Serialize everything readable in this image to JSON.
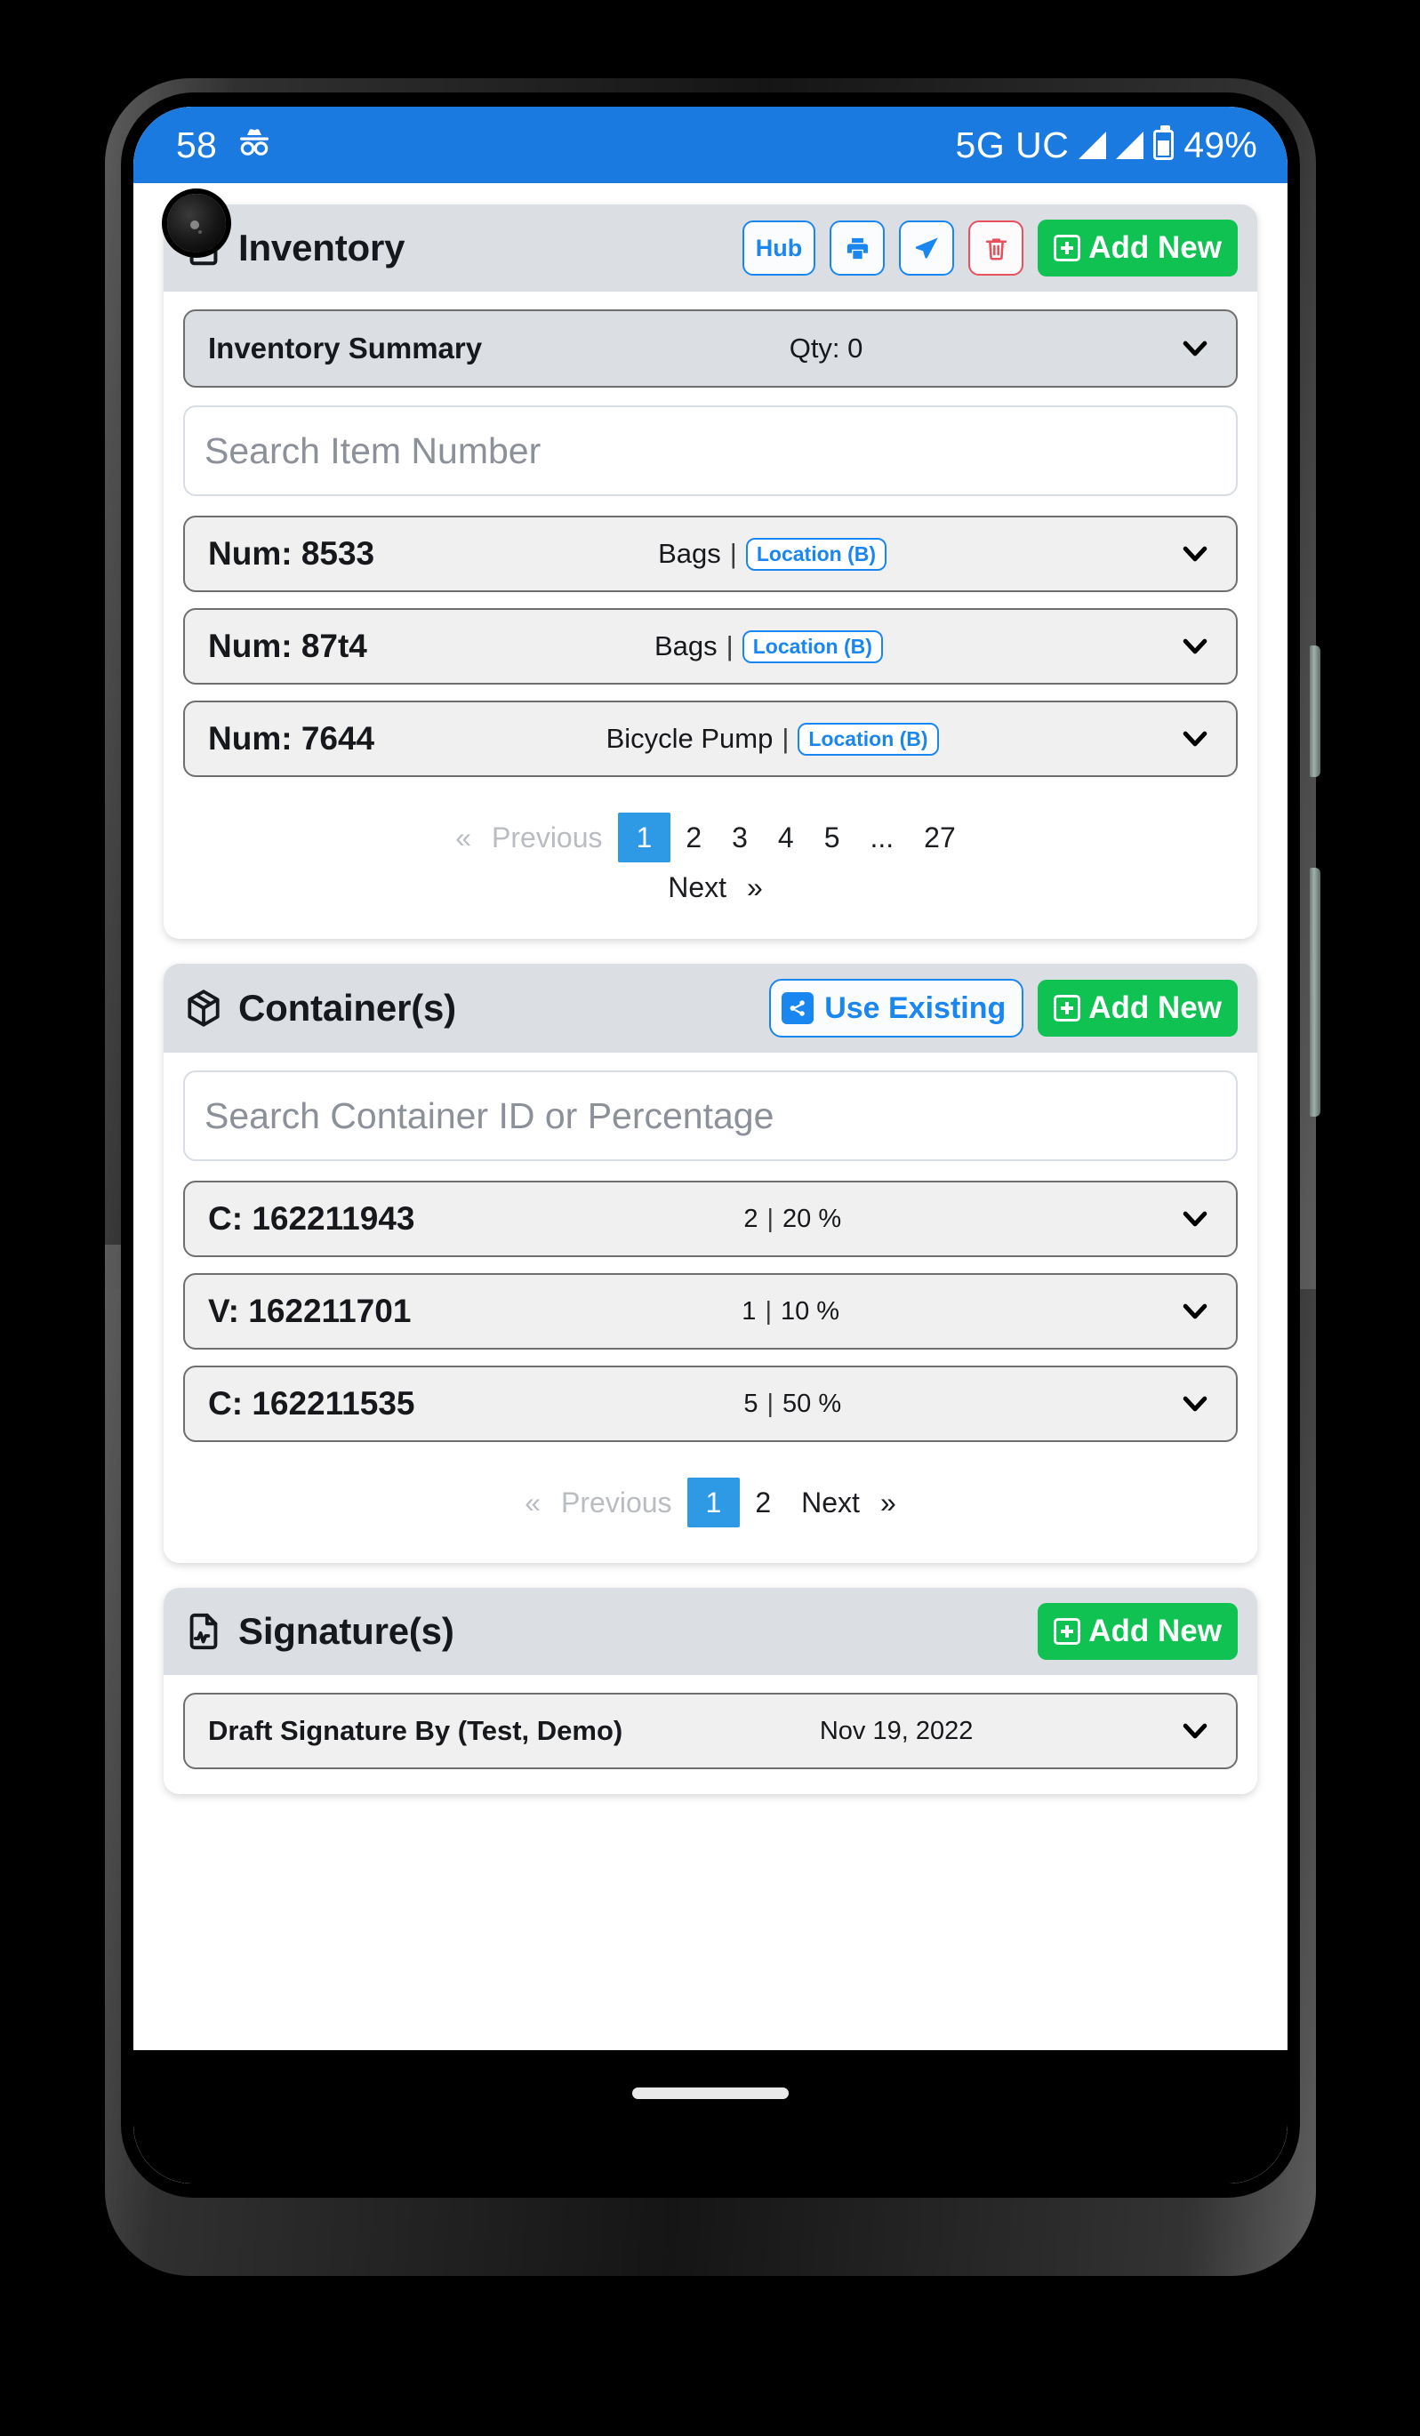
{
  "status_bar": {
    "time": "58",
    "incognito_icon": "incognito-icon",
    "network": "5G UC",
    "battery_percent": "49%"
  },
  "inventory_card": {
    "icon": "inventory-box-icon",
    "title": "Inventory",
    "hub_label": "Hub",
    "print_icon": "printer-icon",
    "send_icon": "paper-plane-icon",
    "delete_icon": "trash-icon",
    "add_new_label": "Add New",
    "summary": {
      "label": "Inventory Summary",
      "qty": "Qty: 0"
    },
    "search_placeholder": "Search Item Number",
    "search_value": "",
    "items": [
      {
        "num": "Num: 8533",
        "desc": "Bags",
        "sep": "|",
        "location": "Location (B)"
      },
      {
        "num": "Num: 87t4",
        "desc": "Bags",
        "sep": "|",
        "location": "Location (B)"
      },
      {
        "num": "Num: 7644",
        "desc": "Bicycle Pump",
        "sep": "|",
        "location": "Location (B)"
      }
    ],
    "pagination": {
      "prev_chevron": "«",
      "prev_label": "Previous",
      "pages": [
        "1",
        "2",
        "3",
        "4",
        "5",
        "...",
        "27"
      ],
      "active_page": "1",
      "next_label": "Next",
      "next_chevron": "»"
    }
  },
  "container_card": {
    "icon": "container-cube-icon",
    "title": "Container(s)",
    "use_existing_label": "Use Existing",
    "share_icon": "share-icon",
    "add_new_label": "Add New",
    "search_placeholder": "Search Container ID or Percentage",
    "search_value": "",
    "items": [
      {
        "id": "C: 162211943",
        "qty": "2",
        "sep": "|",
        "pct": "20 %"
      },
      {
        "id": "V: 162211701",
        "qty": "1",
        "sep": "|",
        "pct": "10 %"
      },
      {
        "id": "C: 162211535",
        "qty": "5",
        "sep": "|",
        "pct": "50 %"
      }
    ],
    "pagination": {
      "prev_chevron": "«",
      "prev_label": "Previous",
      "pages": [
        "1",
        "2"
      ],
      "active_page": "1",
      "next_label": "Next",
      "next_chevron": "»"
    }
  },
  "signature_card": {
    "icon": "signature-document-icon",
    "title": "Signature(s)",
    "add_new_label": "Add New",
    "items": [
      {
        "label": "Draft Signature By  (Test, Demo)",
        "date": "Nov 19, 2022"
      }
    ]
  },
  "colors": {
    "status_bar_blue": "#1b7ae0",
    "accent_blue": "#1a86f0",
    "pager_blue": "#2e9ae6",
    "green": "#0fc252",
    "danger_red": "#e8505e",
    "card_header_gray": "#dbdfe4",
    "row_gray": "#f0f0f0"
  }
}
